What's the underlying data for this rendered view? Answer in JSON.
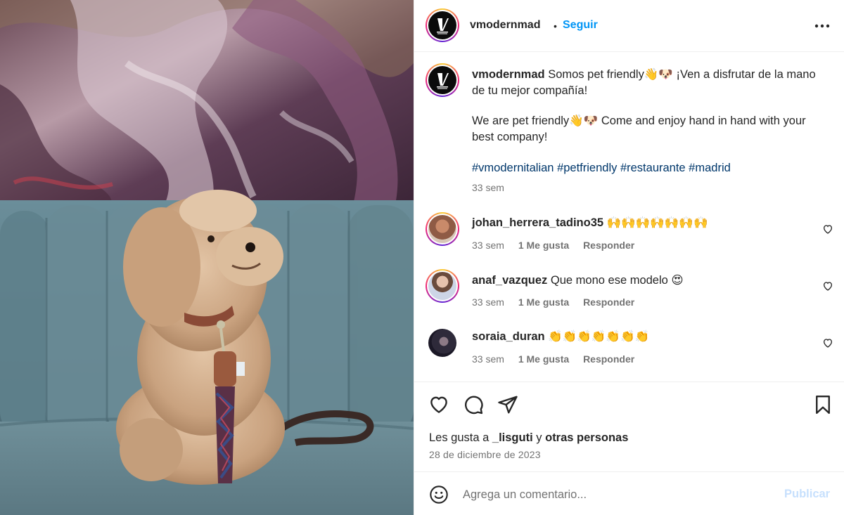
{
  "post": {
    "author": "vmodernmad",
    "separator": "•",
    "follow_label": "Seguir",
    "more_icon": "more-horizontal-icon"
  },
  "caption": {
    "username": "vmodernmad",
    "line_es": "Somos pet friendly👋🐶 ¡Ven a disfrutar de la mano de tu mejor compañía!",
    "line_en": "We are pet friendly👋🐶 Come and enjoy hand in hand with your best company!",
    "hashtags": "#vmodernitalian #petfriendly #restaurante #madrid",
    "time": "33 sem"
  },
  "comments": [
    {
      "username": "johan_herrera_tadino35",
      "text": "🙌🙌🙌🙌🙌🙌🙌",
      "time": "33 sem",
      "likes": "1 Me gusta",
      "reply": "Responder"
    },
    {
      "username": "anaf_vazquez",
      "text": "Que mono ese modelo 😍",
      "time": "33 sem",
      "likes": "1 Me gusta",
      "reply": "Responder"
    },
    {
      "username": "soraia_duran",
      "text": "👏👏👏👏👏👏👏",
      "time": "33 sem",
      "likes": "1 Me gusta",
      "reply": "Responder"
    }
  ],
  "actions": {
    "like_icon": "heart-icon",
    "comment_icon": "comment-icon",
    "share_icon": "paper-plane-icon",
    "save_icon": "bookmark-icon"
  },
  "likes": {
    "prefix": "Les gusta a",
    "user": "_lisguti",
    "conj": "y",
    "others": "otras personas"
  },
  "date": "28 de diciembre de 2023",
  "add_comment": {
    "placeholder": "Agrega un comentario...",
    "publish_label": "Publicar"
  }
}
